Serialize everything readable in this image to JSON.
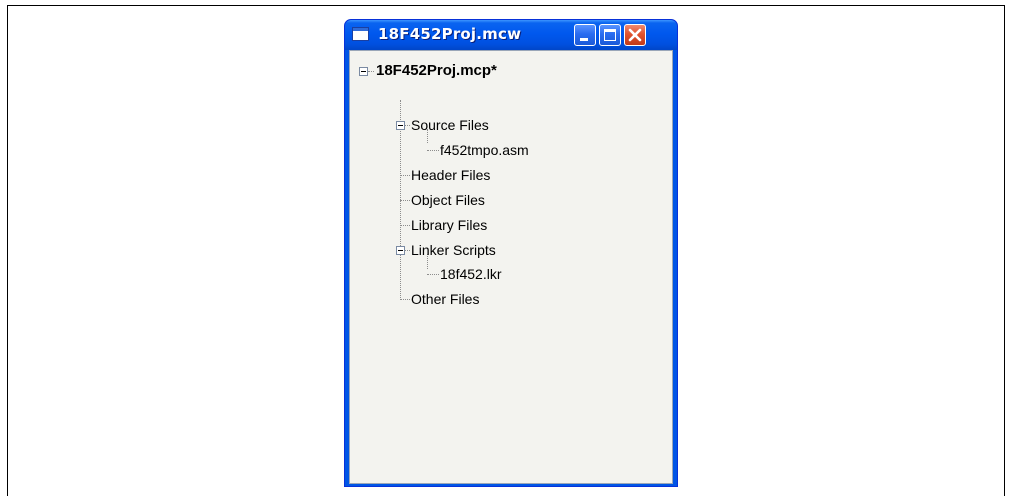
{
  "window": {
    "title": "18F452Proj.mcw",
    "icon": "window-icon",
    "controls": {
      "minimize_icon": "minimize-icon",
      "maximize_icon": "maximize-icon",
      "close_icon": "close-icon"
    },
    "colors": {
      "titlebar": "#0058ee",
      "close": "#e0532f",
      "client_background": "#f3f3ef"
    }
  },
  "tree": {
    "root": {
      "label": "18F452Proj.mcp*",
      "expanded": true
    },
    "nodes": [
      {
        "label": "Source Files",
        "expanded": true,
        "children": [
          {
            "label": "f452tmpo.asm"
          }
        ]
      },
      {
        "label": "Header Files"
      },
      {
        "label": "Object Files"
      },
      {
        "label": "Library Files"
      },
      {
        "label": "Linker Scripts",
        "expanded": true,
        "children": [
          {
            "label": "18f452.lkr"
          }
        ]
      },
      {
        "label": "Other Files"
      }
    ]
  }
}
